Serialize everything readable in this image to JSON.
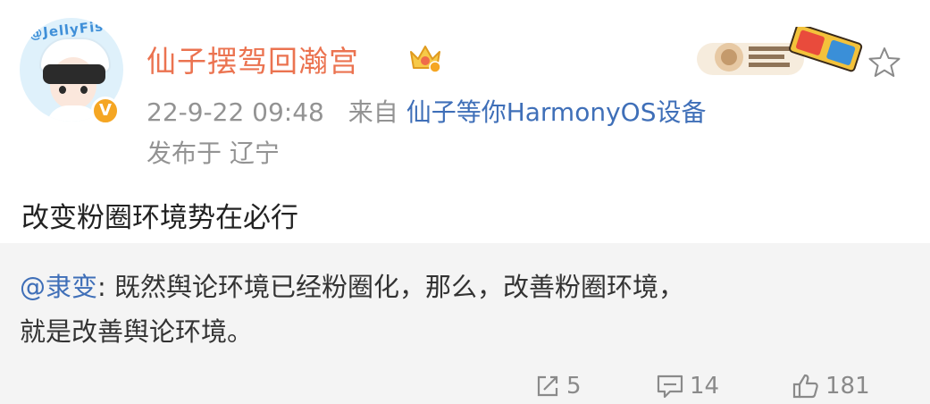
{
  "post": {
    "author": {
      "name": "仙子摆驾回瀚宫",
      "avatar_text": "@JellyFish",
      "verified_badge": "V"
    },
    "meta": {
      "time": "22-9-22 09:48",
      "from_label": "来自",
      "source": "仙子等你HarmonyOS设备"
    },
    "location": "发布于 辽宁",
    "text": "改变粉圈环境势在必行"
  },
  "quote": {
    "mention": "@隶变",
    "separator": ":",
    "line1_rest": " 既然舆论环境已经粉圈化，那么，改善粉圈环境，",
    "line2": "就是改善舆论环境。"
  },
  "actions": {
    "repost_count": "5",
    "comment_count": "14",
    "like_count": "181"
  },
  "colors": {
    "username": "#eb7350",
    "link": "#3f6fb8",
    "meta": "#939393",
    "quote_bg": "#f4f4f4"
  }
}
